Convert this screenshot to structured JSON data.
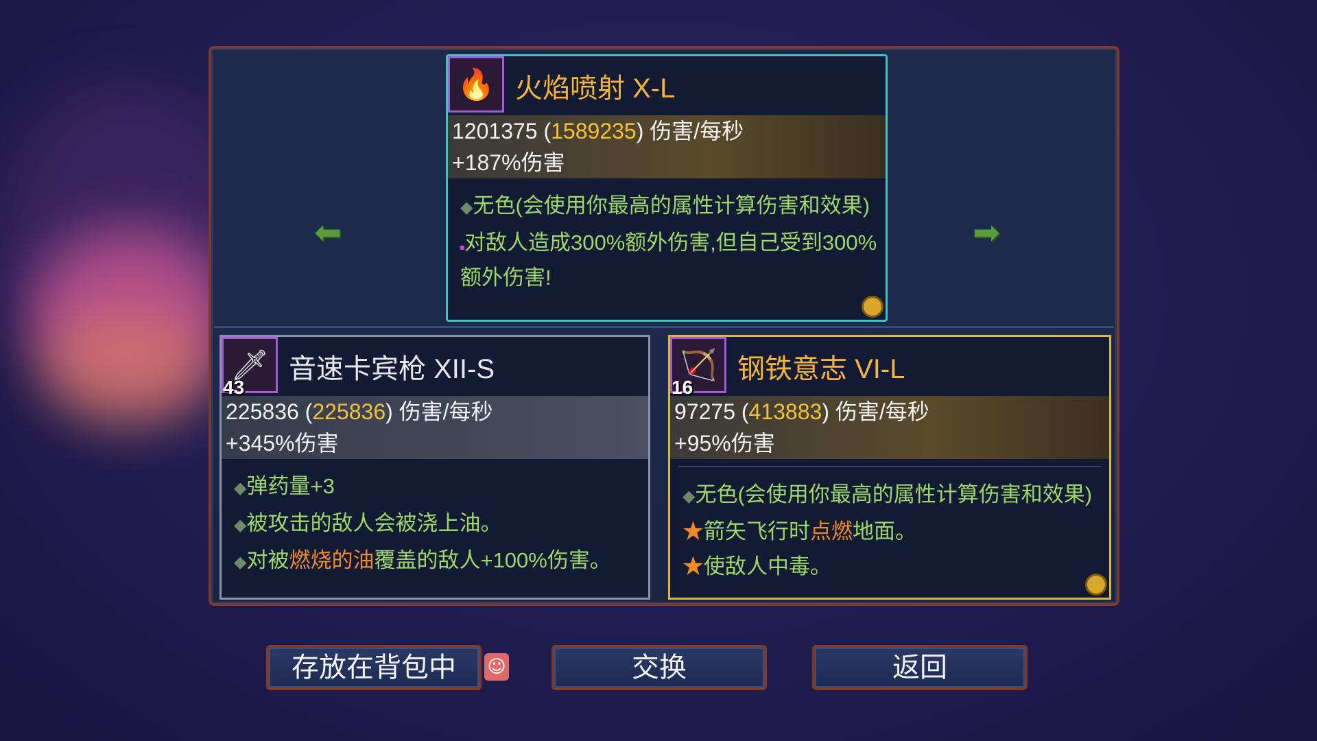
{
  "arrows": {
    "left": "left-arrow-icon",
    "right": "right-arrow-icon"
  },
  "top_item": {
    "icon": "flamethrower-icon",
    "name": "火焰喷射 X-L",
    "dps_value": "1201375",
    "dps_alt": "1589235",
    "dps_unit": "伤害/每秒",
    "bonus": "+187%伤害",
    "desc1": "无色(会使用你最高的属性计算伤害和效果)",
    "desc2": "对敌人造成300%额外伤害,但自己受到300%额外伤害!"
  },
  "left_item": {
    "icon": "rifle-icon",
    "level": "43",
    "name": "音速卡宾枪 XII-S",
    "dps_value": "225836",
    "dps_alt": "225836",
    "dps_unit": "伤害/每秒",
    "bonus": "+345%伤害",
    "desc1": "弹药量+3",
    "desc2": "被攻击的敌人会被浇上油。",
    "desc3_prefix": "对被",
    "desc3_highlight": "燃烧的油",
    "desc3_suffix": "覆盖的敌人+100%伤害。"
  },
  "right_item": {
    "icon": "bow-icon",
    "level": "16",
    "name": "钢铁意志 VI-L",
    "dps_value": "97275",
    "dps_alt": "413883",
    "dps_unit": "伤害/每秒",
    "bonus": "+95%伤害",
    "desc1": "无色(会使用你最高的属性计算伤害和效果)",
    "desc2_prefix": "箭矢飞行时",
    "desc2_highlight": "点燃",
    "desc2_suffix": "地面。",
    "desc3": "使敌人中毒。"
  },
  "buttons": {
    "store": "存放在背包中",
    "swap": "交换",
    "back": "返回"
  },
  "colors": {
    "accent_gold": "#f2c23a",
    "frame": "#7a3a2e",
    "top_border": "#3fc4c6",
    "right_border": "#e0b73a"
  }
}
